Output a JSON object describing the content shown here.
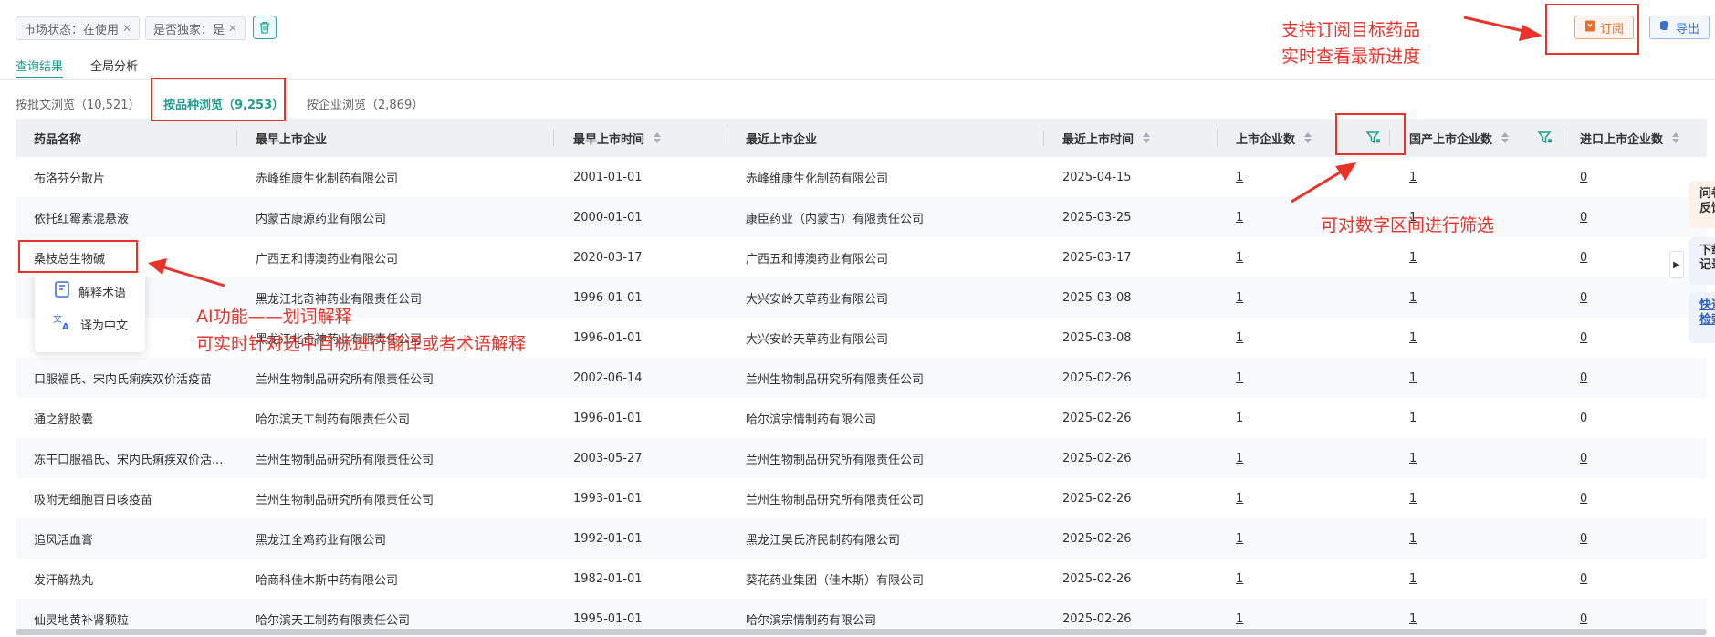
{
  "filters": {
    "chips": [
      {
        "label": "市场状态：在使用"
      },
      {
        "label": "是否独家：是"
      }
    ],
    "clear_icon": "trash-icon"
  },
  "tabs": [
    {
      "label": "查询结果",
      "active": true
    },
    {
      "label": "全局分析",
      "active": false
    }
  ],
  "subtabs": [
    {
      "label": "按批文浏览（10,521）",
      "active": false
    },
    {
      "label": "按品种浏览（9,253）",
      "active": true
    },
    {
      "label": "按企业浏览（2,869）",
      "active": false
    }
  ],
  "actions": {
    "subscribe_label": "订阅",
    "export_label": "导出"
  },
  "table": {
    "columns": [
      "药品名称",
      "最早上市企业",
      "最早上市时间",
      "最近上市企业",
      "最近上市时间",
      "上市企业数",
      "国产上市企业数",
      "进口上市企业数"
    ],
    "rows": [
      [
        "布洛芬分散片",
        "赤峰维康生化制药有限公司",
        "2001-01-01",
        "赤峰维康生化制药有限公司",
        "2025-04-15",
        "1",
        "1",
        "0"
      ],
      [
        "依托红霉素混悬液",
        "内蒙古康源药业有限公司",
        "2000-01-01",
        "康臣药业（内蒙古）有限责任公司",
        "2025-03-25",
        "1",
        "1",
        "0"
      ],
      [
        "桑枝总生物碱",
        "广西五和博澳药业有限公司",
        "2020-03-17",
        "广西五和博澳药业有限公司",
        "2025-03-17",
        "1",
        "1",
        "0"
      ],
      [
        "",
        "黑龙江北奇神药业有限责任公司",
        "1996-01-01",
        "大兴安岭天草药业有限公司",
        "2025-03-08",
        "1",
        "1",
        "0"
      ],
      [
        "",
        "黑龙江北奇神药业有限责任公司",
        "1996-01-01",
        "大兴安岭天草药业有限公司",
        "2025-03-08",
        "1",
        "1",
        "0"
      ],
      [
        "口服福氏、宋内氏痢疾双价活疫苗",
        "兰州生物制品研究所有限责任公司",
        "2002-06-14",
        "兰州生物制品研究所有限责任公司",
        "2025-02-26",
        "1",
        "1",
        "0"
      ],
      [
        "通之舒胶囊",
        "哈尔滨天工制药有限责任公司",
        "1996-01-01",
        "哈尔滨宗情制药有限公司",
        "2025-02-26",
        "1",
        "1",
        "0"
      ],
      [
        "冻干口服福氏、宋内氏痢疾双价活...",
        "兰州生物制品研究所有限责任公司",
        "2003-05-27",
        "兰州生物制品研究所有限责任公司",
        "2025-02-26",
        "1",
        "1",
        "0"
      ],
      [
        "吸附无细胞百日咳疫苗",
        "兰州生物制品研究所有限责任公司",
        "1993-01-01",
        "兰州生物制品研究所有限责任公司",
        "2025-02-26",
        "1",
        "1",
        "0"
      ],
      [
        "追风活血膏",
        "黑龙江全鸡药业有限公司",
        "1992-01-01",
        "黑龙江吴氏济民制药有限公司",
        "2025-02-26",
        "1",
        "1",
        "0"
      ],
      [
        "发汗解热丸",
        "哈商科佳木斯中药有限公司",
        "1982-01-01",
        "葵花药业集团（佳木斯）有限公司",
        "2025-02-26",
        "1",
        "1",
        "0"
      ],
      [
        "仙灵地黄补肾颗粒",
        "哈尔滨天工制药有限责任公司",
        "1995-01-01",
        "哈尔滨宗情制药有限公司",
        "2025-02-26",
        "1",
        "1",
        "0"
      ]
    ]
  },
  "popup": {
    "items": [
      {
        "label": "解释术语",
        "icon": "book-icon"
      },
      {
        "label": "译为中文",
        "icon": "translate-icon"
      }
    ]
  },
  "annotations": {
    "subscribe_note_1": "支持订阅目标药品",
    "subscribe_note_2": "实时查看最新进度",
    "filter_note": "可对数字区间进行筛选",
    "ai_note_1": "AI功能——划词解释",
    "ai_note_2": "可实时针对选中目标进行翻译或者术语解释"
  },
  "side_panel": {
    "tabs": [
      {
        "line1": "问卷",
        "line2": "反馈"
      },
      {
        "line1": "下载",
        "line2": "记录"
      },
      {
        "line1": "快速",
        "line2": "检索"
      }
    ]
  },
  "colors": {
    "accent": "#1e9e91",
    "annotation": "#e8322a",
    "subscribe": "#ef6b2c",
    "export": "#3a6fd8"
  }
}
